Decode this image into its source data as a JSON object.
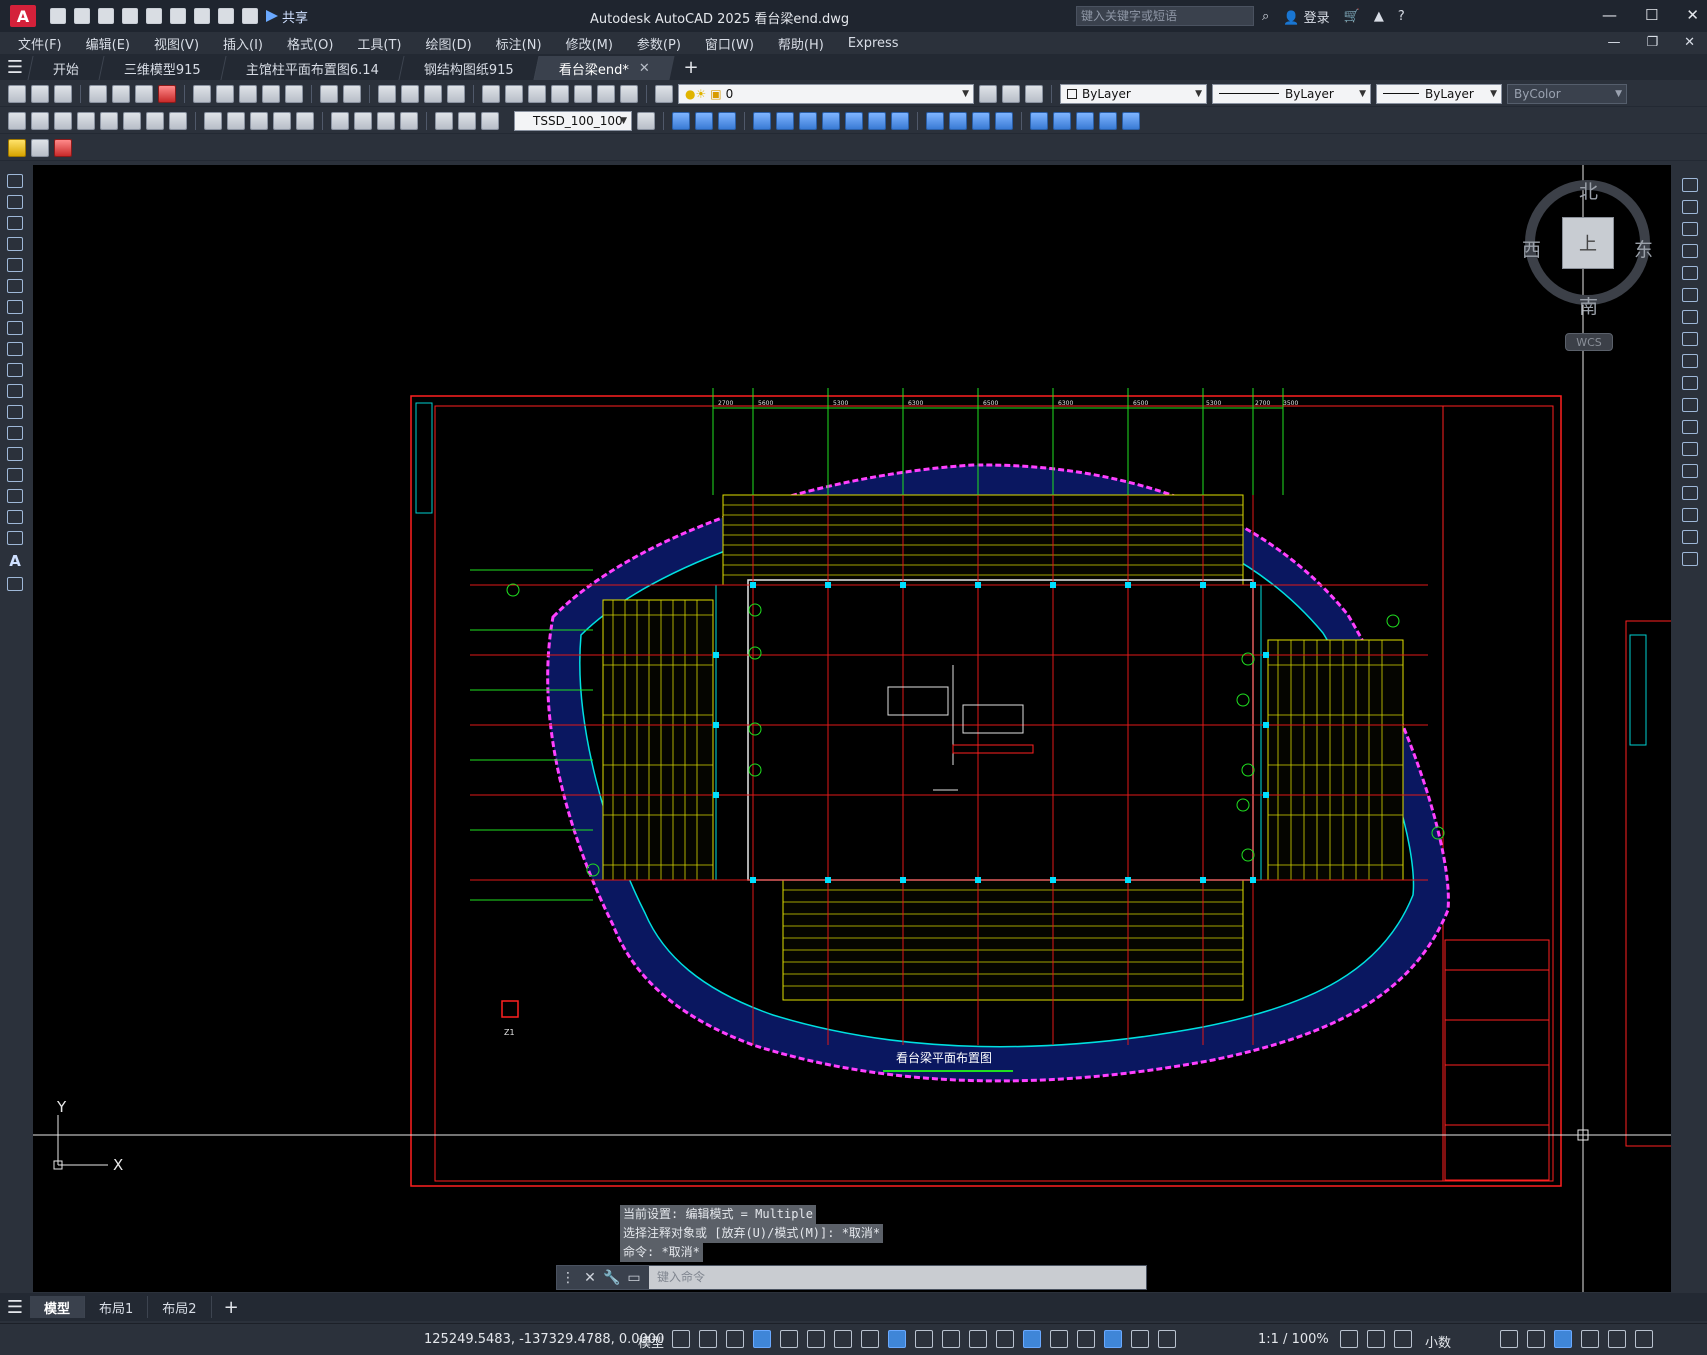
{
  "app": {
    "logo": "A",
    "title": "Autodesk AutoCAD 2025    看台梁end.dwg",
    "share": "共享",
    "search_placeholder": "键入关键字或短语",
    "login": "登录",
    "help": "?"
  },
  "menu": [
    "文件(F)",
    "编辑(E)",
    "视图(V)",
    "插入(I)",
    "格式(O)",
    "工具(T)",
    "绘图(D)",
    "标注(N)",
    "修改(M)",
    "参数(P)",
    "窗口(W)",
    "帮助(H)",
    "Express"
  ],
  "file_tabs": [
    {
      "label": "开始",
      "active": false
    },
    {
      "label": "三维模型915",
      "active": false
    },
    {
      "label": "主馆柱平面布置图6.14",
      "active": false
    },
    {
      "label": "钢结构图纸915",
      "active": false
    },
    {
      "label": "看台梁end*",
      "active": true
    }
  ],
  "toolbar": {
    "layer_value": "0",
    "color_value": "ByLayer",
    "linetype_value": "ByLayer",
    "lineweight_value": "ByLayer",
    "plotstyle_value": "ByColor",
    "dimstyle_value": "TSSD_100_100"
  },
  "viewcube": {
    "north": "北",
    "south": "南",
    "east": "东",
    "west": "西",
    "face": "上",
    "wcs": "WCS"
  },
  "ucs": {
    "x": "X",
    "y": "Y"
  },
  "drawing": {
    "title": "看台梁平面布置图",
    "dimensions": [
      "2700",
      "5600",
      "5300",
      "6300",
      "6500",
      "6300",
      "6500",
      "5300",
      "2700",
      "3500"
    ],
    "column_mark": "Z1"
  },
  "command": {
    "history": [
      "当前设置: 编辑模式 = Multiple",
      "选择注释对象或 [放弃(U)/模式(M)]: *取消*",
      "命令: *取消*"
    ],
    "placeholder": "键入命令"
  },
  "layouts": [
    {
      "label": "模型",
      "active": true
    },
    {
      "label": "布局1",
      "active": false
    },
    {
      "label": "布局2",
      "active": false
    }
  ],
  "status": {
    "coordinates": "125249.5483, -137329.4788, 0.0000",
    "model": "模型",
    "scale": "1:1 / 100%",
    "units": "小数"
  }
}
